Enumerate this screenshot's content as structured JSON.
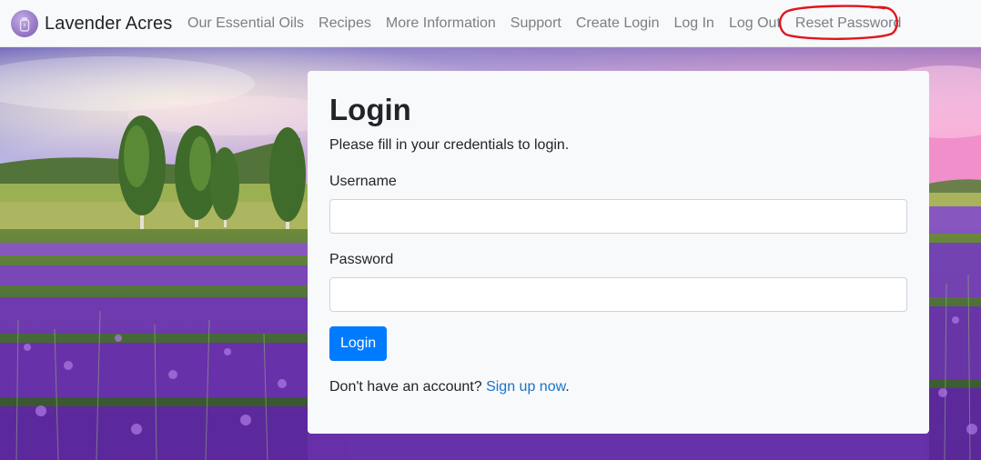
{
  "navbar": {
    "brand": "Lavender Acres",
    "links": [
      {
        "label": "Our Essential Oils"
      },
      {
        "label": "Recipes"
      },
      {
        "label": "More Information"
      },
      {
        "label": "Support"
      },
      {
        "label": "Create Login"
      },
      {
        "label": "Log In"
      },
      {
        "label": "Log Out"
      },
      {
        "label": "Reset Password"
      }
    ],
    "annotation_color": "#e0151d"
  },
  "login": {
    "title": "Login",
    "subtitle": "Please fill in your credentials to login.",
    "username_label": "Username",
    "username_value": "",
    "password_label": "Password",
    "password_value": "",
    "submit_label": "Login",
    "signup_prompt": "Don't have an account?",
    "signup_link": "Sign up now",
    "signup_suffix": "."
  },
  "colors": {
    "primary": "#007bff",
    "link": "#1a73c9",
    "nav_text": "#7b7f84",
    "card_bg": "#f8f9fa"
  }
}
